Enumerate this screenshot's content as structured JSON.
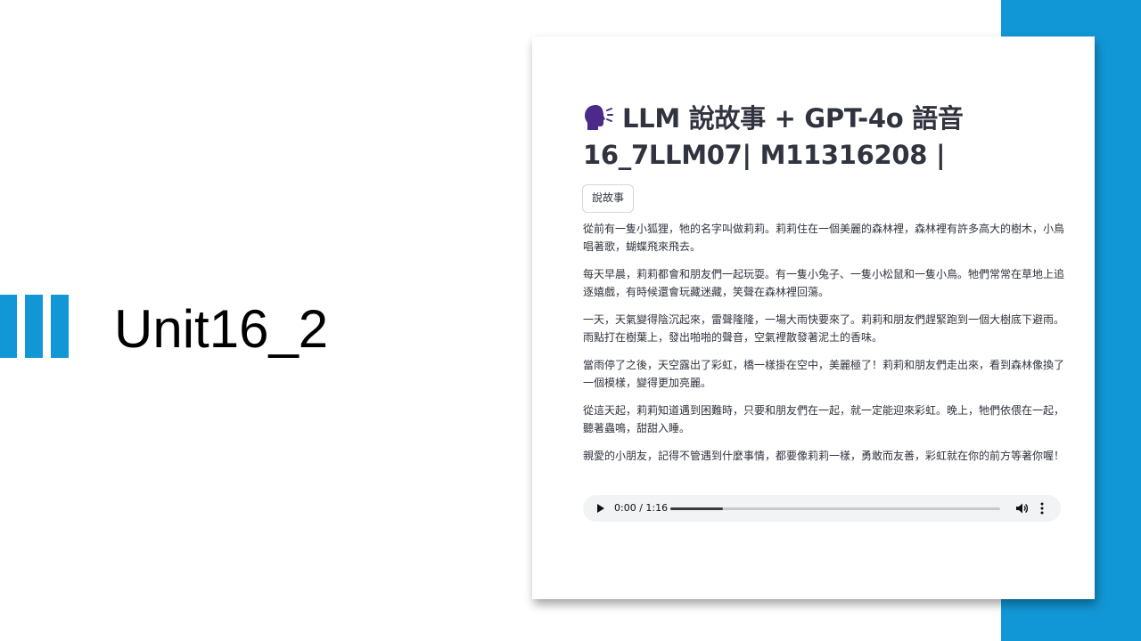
{
  "slide": {
    "title": "Unit16_2",
    "accent_color": "#1197d6"
  },
  "app": {
    "title_line1": "LLM 說故事 + GPT-4o 語音",
    "title_line2": "16_7LLM07| M11316208 |",
    "title_icon": "speaking-head-icon",
    "button_label": "說故事",
    "story_paragraphs": [
      "從前有一隻小狐狸，牠的名字叫做莉莉。莉莉住在一個美麗的森林裡，森林裡有許多高大的樹木，小鳥唱著歌，蝴蝶飛來飛去。",
      "每天早晨，莉莉都會和朋友們一起玩耍。有一隻小兔子、一隻小松鼠和一隻小鳥。牠們常常在草地上追逐嬉戲，有時候還會玩藏迷藏，笑聲在森林裡回蕩。",
      "一天，天氣變得陰沉起來，雷聲隆隆，一場大雨快要來了。莉莉和朋友們趕緊跑到一個大樹底下避雨。雨點打在樹葉上，發出啪啪的聲音，空氣裡散發著泥土的香味。",
      "當雨停了之後，天空露出了彩虹，橋一樣掛在空中，美麗極了！莉莉和朋友們走出來，看到森林像換了一個模樣，變得更加亮麗。",
      "從這天起，莉莉知道遇到困難時，只要和朋友們在一起，就一定能迎來彩虹。晚上，牠們依偎在一起，聽著蟲鳴，甜甜入睡。",
      "親愛的小朋友，記得不管遇到什麼事情，都要像莉莉一樣，勇敢而友善，彩虹就在你的前方等著你喔！"
    ],
    "audio": {
      "time_display": "0:00 / 1:16",
      "progress_fraction": 0.16
    }
  }
}
